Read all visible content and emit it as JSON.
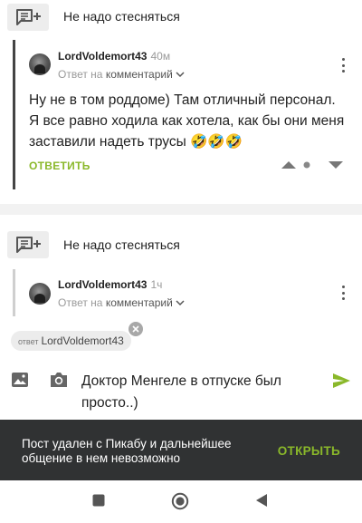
{
  "threads": [
    {
      "title": "Не надо стесняться",
      "comment": {
        "author": "LordVoldemort43",
        "time": "40м",
        "reply_prefix": "Ответ на",
        "reply_link": "комментарий",
        "text": "Ну не в том роддоме) Там отличный персонал. Я все равно ходила как хотела, как бы они меня заставили надеть трусы 🤣🤣🤣",
        "reply_button": "ОТВЕТИТЬ"
      }
    },
    {
      "title": "Не надо стесняться",
      "comment": {
        "author": "LordVoldemort43",
        "time": "1ч",
        "reply_prefix": "Ответ на",
        "reply_link": "комментарий"
      }
    }
  ],
  "composer": {
    "reply_to_prefix": "ответ",
    "reply_to_user": "LordVoldemort43",
    "draft_text": "Доктор Менгеле в отпуске был просто..)"
  },
  "snackbar": {
    "message": "Пост удален с Пикабу и дальнейшее общение в нем невозможно",
    "action": "ОТКРЫТЬ"
  },
  "icons": {
    "thread": "comments-plus-icon",
    "more": "more-vert-icon",
    "vote_up": "vote-up-icon",
    "vote_down": "vote-down-icon",
    "image": "image-icon",
    "camera": "camera-icon",
    "send": "send-icon"
  },
  "colors": {
    "accent": "#8ab82a",
    "snackbar_bg": "#303233",
    "text": "#222222",
    "muted": "#9a9a9a"
  }
}
